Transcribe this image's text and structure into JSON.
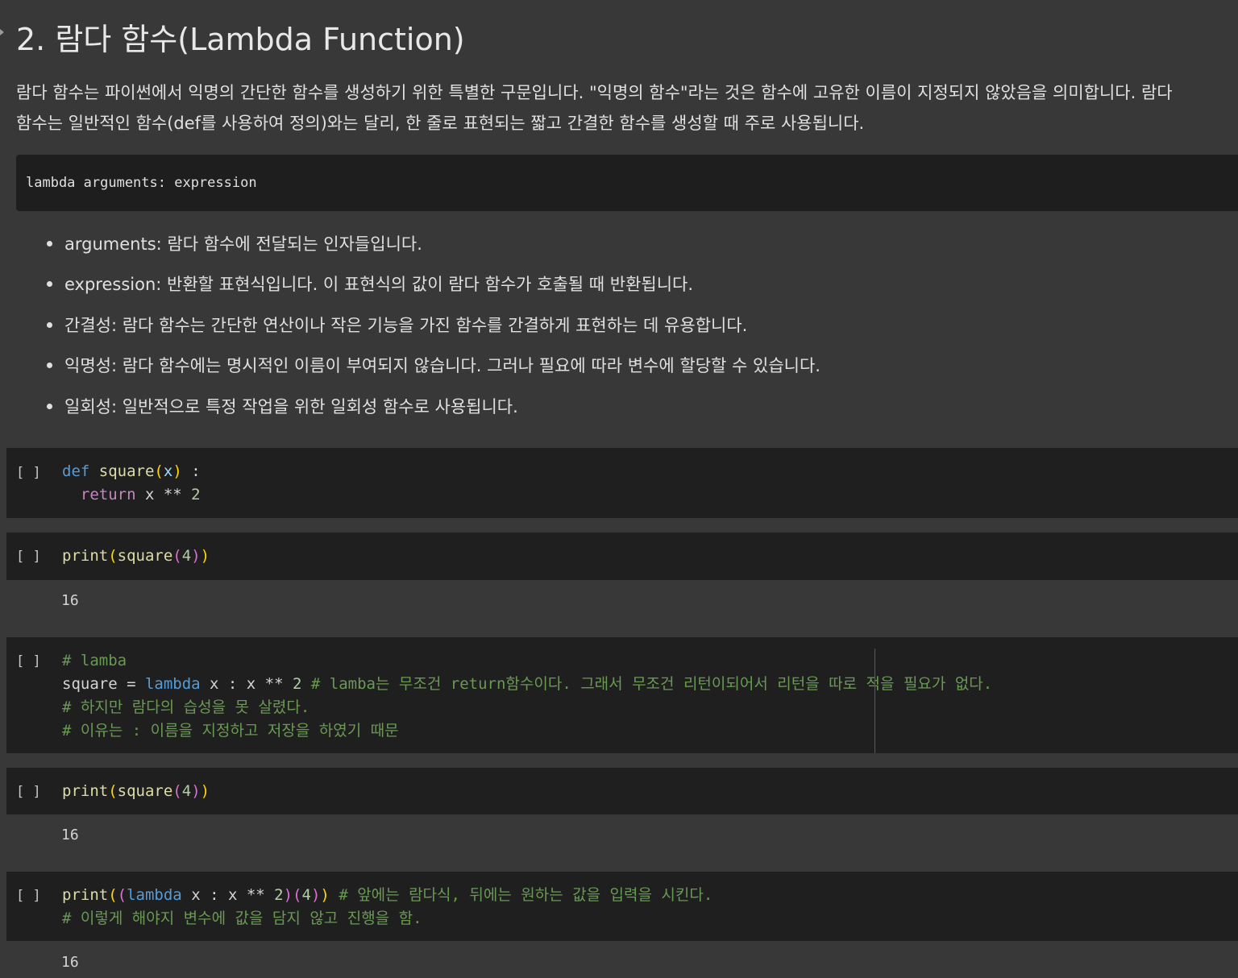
{
  "heading": "2. 람다 함수(Lambda Function)",
  "intro": [
    "람다 함수는 파이썬에서 익명의 간단한 함수를 생성하기 위한 특별한 구문입니다. \"익명의 함수\"라는 것은 함수에 고유한 이름이 지정되지 않았음을 의미합니다. 람다",
    "함수는 일반적인 함수(def를 사용하여 정의)와는 달리, 한 줄로 표현되는 짧고 간결한 함수를 생성할 때 주로 사용됩니다."
  ],
  "syntax": "lambda arguments: expression",
  "bullets": [
    "arguments: 람다 함수에 전달되는 인자들입니다.",
    "expression: 반환할 표현식입니다. 이 표현식의 값이 람다 함수가 호출될 때 반환됩니다.",
    "간결성: 람다 함수는 간단한 연산이나 작은 기능을 가진 함수를 간결하게 표현하는 데 유용합니다.",
    "익명성: 람다 함수에는 명시적인 이름이 부여되지 않습니다. 그러나 필요에 따라 변수에 할당할 수 있습니다.",
    "일회성: 일반적으로 특정 작업을 위한 일회성 함수로 사용됩니다."
  ],
  "run_indicator": "[ ]",
  "cells": [
    {
      "lines": [
        [
          {
            "t": "def",
            "c": "kw"
          },
          {
            "t": " "
          },
          {
            "t": "square",
            "c": "fn"
          },
          {
            "t": "(",
            "c": "br1"
          },
          {
            "t": "x",
            "c": "vr"
          },
          {
            "t": ")",
            "c": "br1"
          },
          {
            "t": " :"
          }
        ],
        [
          {
            "t": "  "
          },
          {
            "t": "return",
            "c": "kw2"
          },
          {
            "t": " x ** "
          },
          {
            "t": "2",
            "c": "num"
          }
        ]
      ],
      "output": ""
    },
    {
      "lines": [
        [
          {
            "t": "print",
            "c": "fn"
          },
          {
            "t": "(",
            "c": "br1"
          },
          {
            "t": "square",
            "c": "fn"
          },
          {
            "t": "(",
            "c": "br2"
          },
          {
            "t": "4",
            "c": "num"
          },
          {
            "t": ")",
            "c": "br2"
          },
          {
            "t": ")",
            "c": "br1"
          }
        ]
      ],
      "output": "16"
    },
    {
      "lines": [
        [
          {
            "t": "# lamba",
            "c": "cm"
          }
        ],
        [
          {
            "t": "square = "
          },
          {
            "t": "lambda",
            "c": "kw"
          },
          {
            "t": " x : x ** "
          },
          {
            "t": "2",
            "c": "num"
          },
          {
            "t": " "
          },
          {
            "t": "# lamba는 무조건 return함수이다. 그래서 무조건 리턴이되어서 리턴을 따로 적을 필요가 없다.",
            "c": "cm"
          }
        ],
        [
          {
            "t": "# 하지만 람다의 습성을 못 살렸다.",
            "c": "cm"
          }
        ],
        [
          {
            "t": "# 이유는 : 이름을 지정하고 저장을 하였기 때문",
            "c": "cm"
          }
        ]
      ],
      "output": ""
    },
    {
      "lines": [
        [
          {
            "t": "print",
            "c": "fn"
          },
          {
            "t": "(",
            "c": "br1"
          },
          {
            "t": "square",
            "c": "fn"
          },
          {
            "t": "(",
            "c": "br2"
          },
          {
            "t": "4",
            "c": "num"
          },
          {
            "t": ")",
            "c": "br2"
          },
          {
            "t": ")",
            "c": "br1"
          }
        ]
      ],
      "output": "16"
    },
    {
      "lines": [
        [
          {
            "t": "print",
            "c": "fn"
          },
          {
            "t": "(",
            "c": "br1"
          },
          {
            "t": "(",
            "c": "br2"
          },
          {
            "t": "lambda",
            "c": "kw"
          },
          {
            "t": " x : x ** "
          },
          {
            "t": "2",
            "c": "num"
          },
          {
            "t": ")",
            "c": "br2"
          },
          {
            "t": "(",
            "c": "br2"
          },
          {
            "t": "4",
            "c": "num"
          },
          {
            "t": ")",
            "c": "br2"
          },
          {
            "t": ")",
            "c": "br1"
          },
          {
            "t": " "
          },
          {
            "t": "# 앞에는 람다식, 뒤에는 원하는 값을 입력을 시킨다.",
            "c": "cm"
          }
        ],
        [
          {
            "t": "# 이렇게 해야지 변수에 값을 담지 않고 진행을 함.",
            "c": "cm"
          }
        ]
      ],
      "output": "16"
    }
  ]
}
